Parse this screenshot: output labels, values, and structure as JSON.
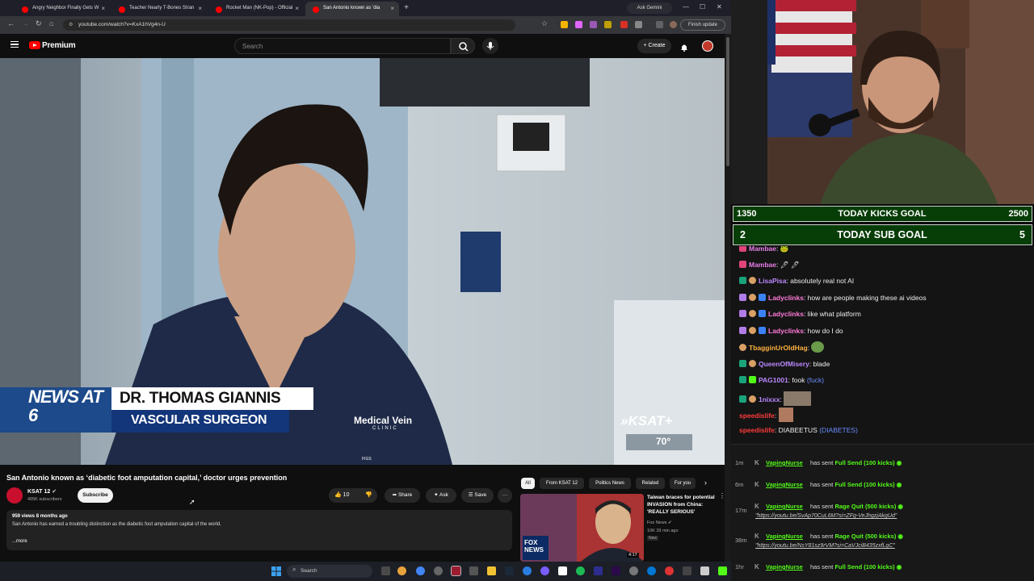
{
  "browser": {
    "tabs": [
      {
        "label": "Angry Neighbor Finally Gets W"
      },
      {
        "label": "Teacher Nearly T-Bones Stran"
      },
      {
        "label": "Rocket Man (NK-Pop) - Official"
      },
      {
        "label": "San Antonio known as 'dia"
      }
    ],
    "new_tab": "+",
    "gemini": "Ask Gemini",
    "url": "youtube.com/watch?v=KxA1hVg4n-U",
    "finish_update": "Finish update"
  },
  "youtube": {
    "brand": "Premium",
    "search_placeholder": "Search",
    "create_label": "+ Create",
    "video": {
      "lower_third_show": "NEWS AT 6",
      "lower_third_name": "DR. THOMAS GIANNIS",
      "lower_third_role": "VASCULAR SURGEON",
      "clinic": "Medical Vein",
      "clinic_sub": "CLINIC",
      "station": "KSAT",
      "temp": "70°",
      "scrubs_label": "FIGS"
    },
    "title": "San Antonio known as ‘diabetic foot amputation capital,’ doctor urges prevention",
    "channel": "KSAT 12",
    "subscribers": "495K subscribers",
    "subscribe": "Subscribe",
    "likes": "10",
    "share": "Share",
    "ask": "Ask",
    "save": "Save",
    "more_actions": "···",
    "views": "959 views  8 months ago",
    "description": "San Antonio has earned a troubling distinction as the diabetic foot amputation capital of the world.",
    "more": "...more",
    "chips": [
      "All",
      "From KSAT 12",
      "Politics News",
      "Related",
      "For you"
    ],
    "related": {
      "title": "Taiwan braces for potential INVASION from China: 'REALLY SERIOUS'",
      "channel": "Fox News",
      "meta": "10K  39 min ago",
      "new": "New",
      "duration": "4:17",
      "thumb_logo": "FOX NEWS"
    }
  },
  "taskbar": {
    "search": "Search"
  },
  "stream": {
    "goals": [
      {
        "left": "1350",
        "label": "TODAY KICKS GOAL",
        "right": "2500"
      },
      {
        "left": "2",
        "label": "TODAY SUB GOAL",
        "right": "5"
      }
    ],
    "chat": [
      {
        "user": "Mambae",
        "color": "#e87ee8",
        "text": ":"
      },
      {
        "user": "Mambae",
        "color": "#e87ee8",
        "text": ":"
      },
      {
        "user": "LisaPisa",
        "color": "#bb88ff",
        "text": ": absolutely real not AI"
      },
      {
        "user": "Ladyclinks",
        "color": "#ff7ad9",
        "text": ": how are people making these ai videos"
      },
      {
        "user": "Ladyclinks",
        "color": "#ff7ad9",
        "text": ": like what platform"
      },
      {
        "user": "Ladyclinks",
        "color": "#ff7ad9",
        "text": ": how do I do"
      },
      {
        "user": "TbagginUrOldHag",
        "color": "#ffb23f",
        "text": ":"
      },
      {
        "user": "QueenOfMisery",
        "color": "#bb88ff",
        "text": ": blade"
      },
      {
        "user": "PAG1001",
        "color": "#bb88ff",
        "text": ": fook",
        "extra": "(fuck)"
      },
      {
        "user": "1nixxx",
        "color": "#bb88ff",
        "text": ":"
      },
      {
        "user": "speedislife",
        "color": "#ff3b3b",
        "text": ":"
      },
      {
        "user": "speedislife",
        "color": "#ff3b3b",
        "text": ": DIABEETUS",
        "extra": "(DIABETES)"
      }
    ],
    "alerts": [
      {
        "time": "1m",
        "user": "VapingNurse",
        "action": "has sent",
        "gift": "Full Send (100 kicks)"
      },
      {
        "time": "6m",
        "user": "VapingNurse",
        "action": "has sent",
        "gift": "Full Send (100 kicks)"
      },
      {
        "time": "17m",
        "user": "VapingNurse",
        "action": "has sent",
        "gift": "Rage Quit (500 kicks)",
        "link": "\"https://youtu.be/SvAp70CuL6M?si=ZFg-VeJhgzjAkgUd\""
      },
      {
        "time": "38m",
        "user": "VapingNurse",
        "action": "has sent",
        "gift": "Rage Quit (500 kicks)",
        "link": "\"https://youtu.be/NsY81sz9rVM?si=CaVJciB435zxfLgC\""
      },
      {
        "time": "1hr",
        "user": "VapingNurse",
        "action": "has sent",
        "gift": "Full Send (100 kicks)"
      }
    ]
  }
}
